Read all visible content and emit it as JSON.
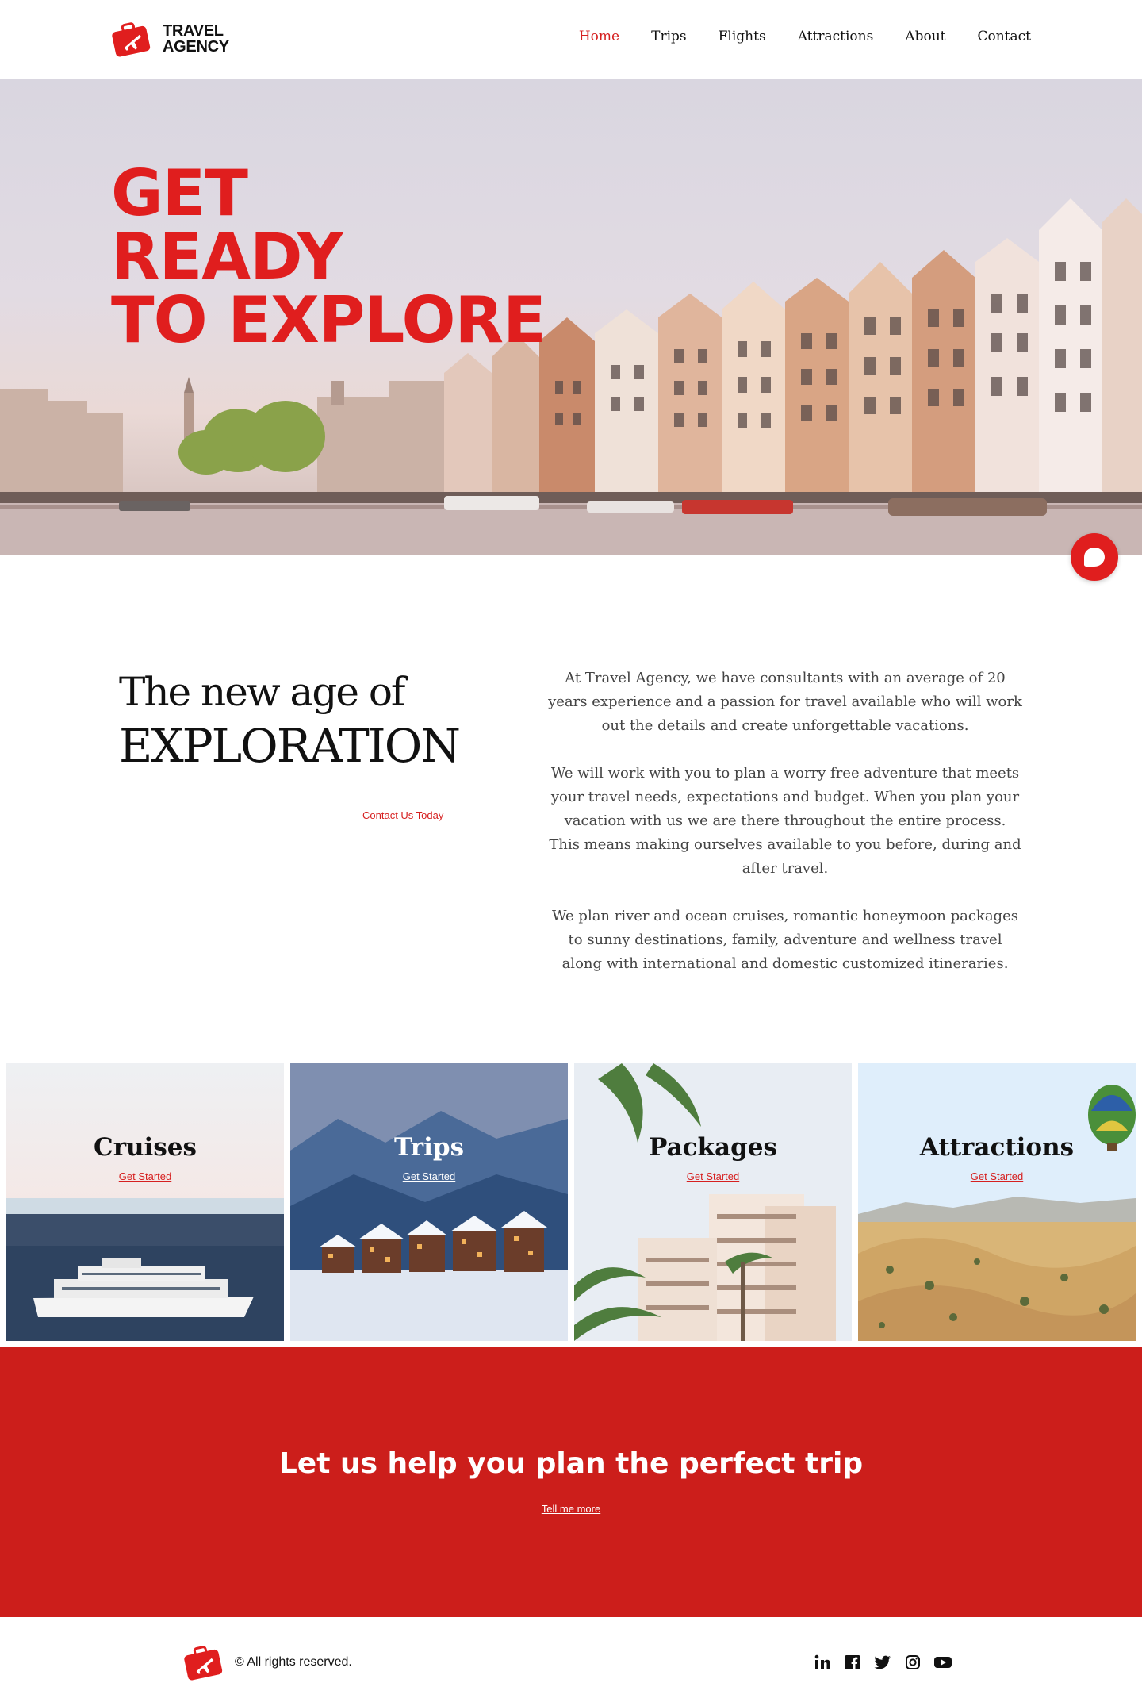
{
  "brand": {
    "name_line1": "TRAVEL",
    "name_line2": "AGENCY",
    "accent_color": "#e01e1e",
    "cta_color": "#cc1e1b"
  },
  "nav": {
    "items": [
      {
        "label": "Home",
        "active": true
      },
      {
        "label": "Trips",
        "active": false
      },
      {
        "label": "Flights",
        "active": false
      },
      {
        "label": "Attractions",
        "active": false
      },
      {
        "label": "About",
        "active": false
      },
      {
        "label": "Contact",
        "active": false
      }
    ]
  },
  "hero": {
    "line1": "GET",
    "line2": "READY",
    "line3": "TO EXPLORE",
    "chat_icon": "chat-bubble-icon"
  },
  "about": {
    "heading_line1": "The new age of",
    "heading_line2": "EXPLORATION",
    "contact_link": "Contact Us Today",
    "paragraphs": [
      "At Travel Agency, we have consultants with an average of 20 years experience and a passion for travel available who will work out the details and create unforgettable vacations.",
      "We will work with you to plan a worry free adventure that meets your travel needs, expectations and budget. When you plan your vacation with us we are there throughout the entire process.  This means making ourselves available to you before, during and after travel.",
      "We plan river and ocean cruises, romantic honeymoon packages to sunny destinations, family, adventure and wellness travel along with international and domestic customized itineraries."
    ]
  },
  "tiles": [
    {
      "title": "Cruises",
      "link": "Get Started"
    },
    {
      "title": "Trips",
      "link": "Get Started"
    },
    {
      "title": "Packages",
      "link": "Get Started"
    },
    {
      "title": "Attractions",
      "link": "Get Started"
    }
  ],
  "cta": {
    "title": "Let us help you plan the perfect trip",
    "link": "Tell me more"
  },
  "footer": {
    "copyright": "© All rights reserved.",
    "socials": [
      "linkedin-icon",
      "facebook-icon",
      "twitter-icon",
      "instagram-icon",
      "youtube-icon"
    ]
  }
}
